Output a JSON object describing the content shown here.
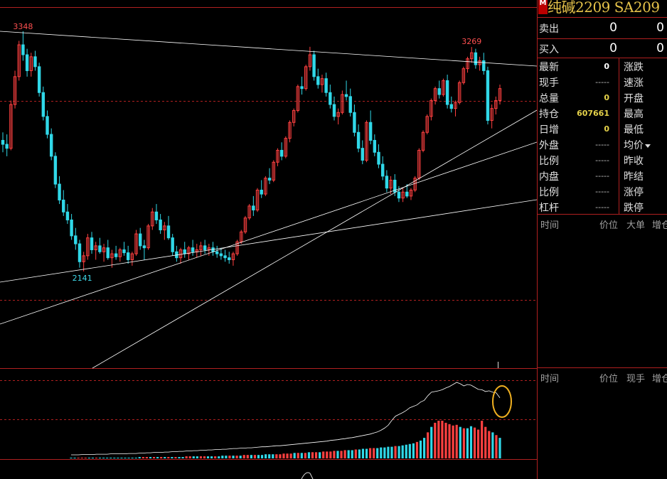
{
  "quote": {
    "title": "纯碱2209  SA209",
    "badge": "M",
    "sell": {
      "label": "卖出",
      "price": "0",
      "volume": "0"
    },
    "buy": {
      "label": "买入",
      "price": "0",
      "volume": "0"
    },
    "left": [
      {
        "label": "最新",
        "value": "0",
        "style": "white"
      },
      {
        "label": "现手",
        "value": "-----",
        "style": "dash"
      },
      {
        "label": "总量",
        "value": "0",
        "style": "yellow"
      },
      {
        "label": "持仓",
        "value": "607661",
        "style": "yellow"
      },
      {
        "label": "日增",
        "value": "0",
        "style": "yellow"
      },
      {
        "label": "外盘",
        "value": "-----",
        "style": "dash"
      },
      {
        "label": "比例",
        "value": "-----",
        "style": "dash"
      },
      {
        "label": "内盘",
        "value": "-----",
        "style": "dash"
      },
      {
        "label": "比例",
        "value": "-----",
        "style": "dash"
      },
      {
        "label": "杠杆",
        "value": "-----",
        "style": "dash"
      }
    ],
    "right": [
      "涨跌",
      "速涨",
      "开盘",
      "最高",
      "最低",
      "均价",
      "昨收",
      "昨结",
      "涨停",
      "跌停"
    ]
  },
  "ticks_header": {
    "time": "时间",
    "price": "价位",
    "big": "大单",
    "add": "增仓"
  },
  "deals_header": {
    "time": "时间",
    "price": "价位",
    "hand": "现手",
    "add": "增仓"
  },
  "chart_data": {
    "type": "candlestick",
    "annotations": {
      "high_left": "3348",
      "low": "2141",
      "high_right": "3269"
    },
    "colors": {
      "up": "#ff4040",
      "down": "#30d8e8",
      "line": "#ffffff",
      "grid": "#b02020",
      "circle": "#f0b020"
    },
    "candles": [
      [
        2800,
        2840,
        2740,
        2780
      ],
      [
        2780,
        2830,
        2720,
        2760
      ],
      [
        2760,
        3000,
        2750,
        2980
      ],
      [
        2980,
        3150,
        2960,
        3120
      ],
      [
        3120,
        3300,
        3100,
        3280
      ],
      [
        3280,
        3348,
        3200,
        3230
      ],
      [
        3230,
        3260,
        3120,
        3150
      ],
      [
        3150,
        3240,
        3120,
        3220
      ],
      [
        3220,
        3250,
        3150,
        3170
      ],
      [
        3170,
        3190,
        3020,
        3040
      ],
      [
        3040,
        3070,
        2900,
        2920
      ],
      [
        2920,
        2950,
        2810,
        2830
      ],
      [
        2830,
        2860,
        2700,
        2720
      ],
      [
        2720,
        2740,
        2560,
        2580
      ],
      [
        2580,
        2620,
        2480,
        2500
      ],
      [
        2500,
        2550,
        2420,
        2440
      ],
      [
        2440,
        2480,
        2380,
        2400
      ],
      [
        2400,
        2430,
        2300,
        2320
      ],
      [
        2320,
        2360,
        2250,
        2280
      ],
      [
        2280,
        2300,
        2160,
        2190
      ],
      [
        2190,
        2240,
        2141,
        2220
      ],
      [
        2220,
        2330,
        2200,
        2310
      ],
      [
        2310,
        2340,
        2230,
        2250
      ],
      [
        2250,
        2290,
        2200,
        2270
      ],
      [
        2270,
        2310,
        2230,
        2240
      ],
      [
        2240,
        2280,
        2190,
        2260
      ],
      [
        2260,
        2300,
        2200,
        2210
      ],
      [
        2210,
        2250,
        2160,
        2230
      ],
      [
        2230,
        2270,
        2200,
        2215
      ],
      [
        2215,
        2260,
        2190,
        2250
      ],
      [
        2250,
        2290,
        2220,
        2235
      ],
      [
        2235,
        2270,
        2180,
        2200
      ],
      [
        2200,
        2240,
        2170,
        2230
      ],
      [
        2230,
        2350,
        2220,
        2330
      ],
      [
        2330,
        2360,
        2250,
        2270
      ],
      [
        2270,
        2300,
        2200,
        2260
      ],
      [
        2260,
        2380,
        2250,
        2370
      ],
      [
        2370,
        2460,
        2350,
        2440
      ],
      [
        2440,
        2480,
        2380,
        2400
      ],
      [
        2400,
        2430,
        2330,
        2350
      ],
      [
        2350,
        2390,
        2300,
        2370
      ],
      [
        2370,
        2420,
        2300,
        2310
      ],
      [
        2310,
        2330,
        2220,
        2240
      ],
      [
        2240,
        2270,
        2190,
        2210
      ],
      [
        2210,
        2260,
        2180,
        2250
      ],
      [
        2250,
        2290,
        2210,
        2230
      ],
      [
        2230,
        2270,
        2200,
        2260
      ],
      [
        2260,
        2300,
        2220,
        2240
      ],
      [
        2240,
        2280,
        2210,
        2250
      ],
      [
        2250,
        2290,
        2220,
        2270
      ],
      [
        2270,
        2300,
        2230,
        2250
      ],
      [
        2250,
        2280,
        2220,
        2260
      ],
      [
        2260,
        2290,
        2220,
        2240
      ],
      [
        2240,
        2270,
        2210,
        2230
      ],
      [
        2230,
        2260,
        2200,
        2220
      ],
      [
        2220,
        2250,
        2190,
        2210
      ],
      [
        2210,
        2240,
        2180,
        2200
      ],
      [
        2200,
        2240,
        2170,
        2230
      ],
      [
        2230,
        2300,
        2220,
        2290
      ],
      [
        2290,
        2350,
        2280,
        2340
      ],
      [
        2340,
        2420,
        2330,
        2410
      ],
      [
        2410,
        2480,
        2400,
        2470
      ],
      [
        2470,
        2520,
        2420,
        2450
      ],
      [
        2450,
        2560,
        2440,
        2550
      ],
      [
        2550,
        2600,
        2510,
        2530
      ],
      [
        2530,
        2620,
        2520,
        2610
      ],
      [
        2610,
        2660,
        2580,
        2600
      ],
      [
        2600,
        2700,
        2590,
        2690
      ],
      [
        2690,
        2760,
        2670,
        2750
      ],
      [
        2750,
        2790,
        2700,
        2720
      ],
      [
        2720,
        2820,
        2710,
        2810
      ],
      [
        2810,
        2900,
        2790,
        2890
      ],
      [
        2890,
        2960,
        2870,
        2950
      ],
      [
        2950,
        3080,
        2940,
        3070
      ],
      [
        3070,
        3120,
        3030,
        3060
      ],
      [
        3060,
        3180,
        3050,
        3170
      ],
      [
        3170,
        3270,
        3150,
        3230
      ],
      [
        3230,
        3250,
        3100,
        3120
      ],
      [
        3120,
        3160,
        3060,
        3080
      ],
      [
        3080,
        3130,
        3040,
        3110
      ],
      [
        3110,
        3140,
        3020,
        3040
      ],
      [
        3040,
        3080,
        2960,
        2980
      ],
      [
        2980,
        3020,
        2900,
        2920
      ],
      [
        2920,
        2960,
        2880,
        2940
      ],
      [
        2940,
        3050,
        2930,
        3030
      ],
      [
        3030,
        3100,
        3000,
        3020
      ],
      [
        3020,
        3060,
        2920,
        2940
      ],
      [
        2940,
        2980,
        2820,
        2840
      ],
      [
        2840,
        2880,
        2740,
        2760
      ],
      [
        2760,
        2800,
        2680,
        2700
      ],
      [
        2700,
        2900,
        2690,
        2890
      ],
      [
        2890,
        2950,
        2780,
        2800
      ],
      [
        2800,
        2830,
        2720,
        2740
      ],
      [
        2740,
        2780,
        2660,
        2680
      ],
      [
        2680,
        2720,
        2600,
        2620
      ],
      [
        2620,
        2650,
        2540,
        2560
      ],
      [
        2560,
        2620,
        2530,
        2600
      ],
      [
        2600,
        2630,
        2520,
        2540
      ],
      [
        2540,
        2570,
        2490,
        2510
      ],
      [
        2510,
        2560,
        2490,
        2540
      ],
      [
        2540,
        2580,
        2510,
        2520
      ],
      [
        2520,
        2560,
        2500,
        2550
      ],
      [
        2550,
        2620,
        2540,
        2610
      ],
      [
        2610,
        2760,
        2600,
        2750
      ],
      [
        2750,
        2850,
        2740,
        2840
      ],
      [
        2840,
        2930,
        2830,
        2920
      ],
      [
        2920,
        3010,
        2900,
        3000
      ],
      [
        3000,
        3070,
        2980,
        3060
      ],
      [
        3060,
        3100,
        3010,
        3030
      ],
      [
        3030,
        3110,
        3020,
        3100
      ],
      [
        3100,
        3130,
        2960,
        2980
      ],
      [
        2980,
        3020,
        2940,
        2960
      ],
      [
        2960,
        3000,
        2920,
        2990
      ],
      [
        2990,
        3100,
        2980,
        3090
      ],
      [
        3090,
        3170,
        3080,
        3160
      ],
      [
        3160,
        3220,
        3140,
        3210
      ],
      [
        3210,
        3269,
        3190,
        3240
      ],
      [
        3240,
        3260,
        3160,
        3180
      ],
      [
        3180,
        3220,
        3150,
        3200
      ],
      [
        3200,
        3240,
        3130,
        3150
      ],
      [
        3150,
        3170,
        2880,
        2900
      ],
      [
        2900,
        2980,
        2860,
        2960
      ],
      [
        2960,
        3020,
        2930,
        3000
      ],
      [
        3000,
        3080,
        2980,
        3060
      ]
    ],
    "volume": [
      1,
      1,
      1,
      1,
      1,
      1,
      1,
      1,
      1,
      1,
      1,
      1,
      1,
      1,
      1,
      1,
      1,
      1,
      1,
      2,
      2,
      2,
      2,
      2,
      2,
      2,
      2,
      2,
      2,
      2,
      2,
      2,
      3,
      3,
      3,
      3,
      3,
      3,
      3,
      3,
      3,
      3,
      4,
      4,
      4,
      4,
      4,
      4,
      5,
      5,
      5,
      5,
      5,
      5,
      6,
      6,
      6,
      6,
      6,
      7,
      7,
      7,
      8,
      8,
      8,
      8,
      9,
      9,
      9,
      9,
      10,
      10,
      10,
      11,
      11,
      11,
      12,
      12,
      12,
      13,
      13,
      14,
      14,
      15,
      15,
      15,
      16,
      16,
      17,
      17,
      18,
      18,
      19,
      20,
      21,
      22,
      24,
      26,
      30,
      38,
      46,
      52,
      55,
      55,
      52,
      50,
      48,
      49,
      46,
      44,
      44,
      47,
      45,
      42,
      55,
      46,
      40,
      38,
      34,
      30
    ],
    "open_interest": [
      10,
      10,
      10,
      11,
      11,
      11,
      11,
      12,
      12,
      12,
      12,
      13,
      13,
      13,
      13,
      13,
      14,
      14,
      14,
      15,
      15,
      16,
      16,
      17,
      17,
      17,
      18,
      18,
      19,
      19,
      20,
      20,
      21,
      21,
      22,
      22,
      23,
      23,
      24,
      24,
      25,
      25,
      26,
      26,
      27,
      28,
      28,
      29,
      29,
      30,
      30,
      31,
      32,
      33,
      33,
      34,
      35,
      36,
      36,
      37,
      38,
      39,
      40,
      41,
      42,
      43,
      44,
      45,
      46,
      47,
      48,
      49,
      51,
      52,
      53,
      55,
      56,
      58,
      59,
      61,
      63,
      65,
      67,
      69,
      72,
      75,
      80,
      86,
      94,
      108,
      120,
      125,
      130,
      136,
      144,
      148,
      152,
      160,
      165,
      178,
      188,
      190,
      192,
      195,
      200,
      204,
      210,
      216,
      212,
      206,
      210,
      208,
      202,
      196,
      195,
      190,
      192,
      188,
      186,
      172
    ]
  }
}
